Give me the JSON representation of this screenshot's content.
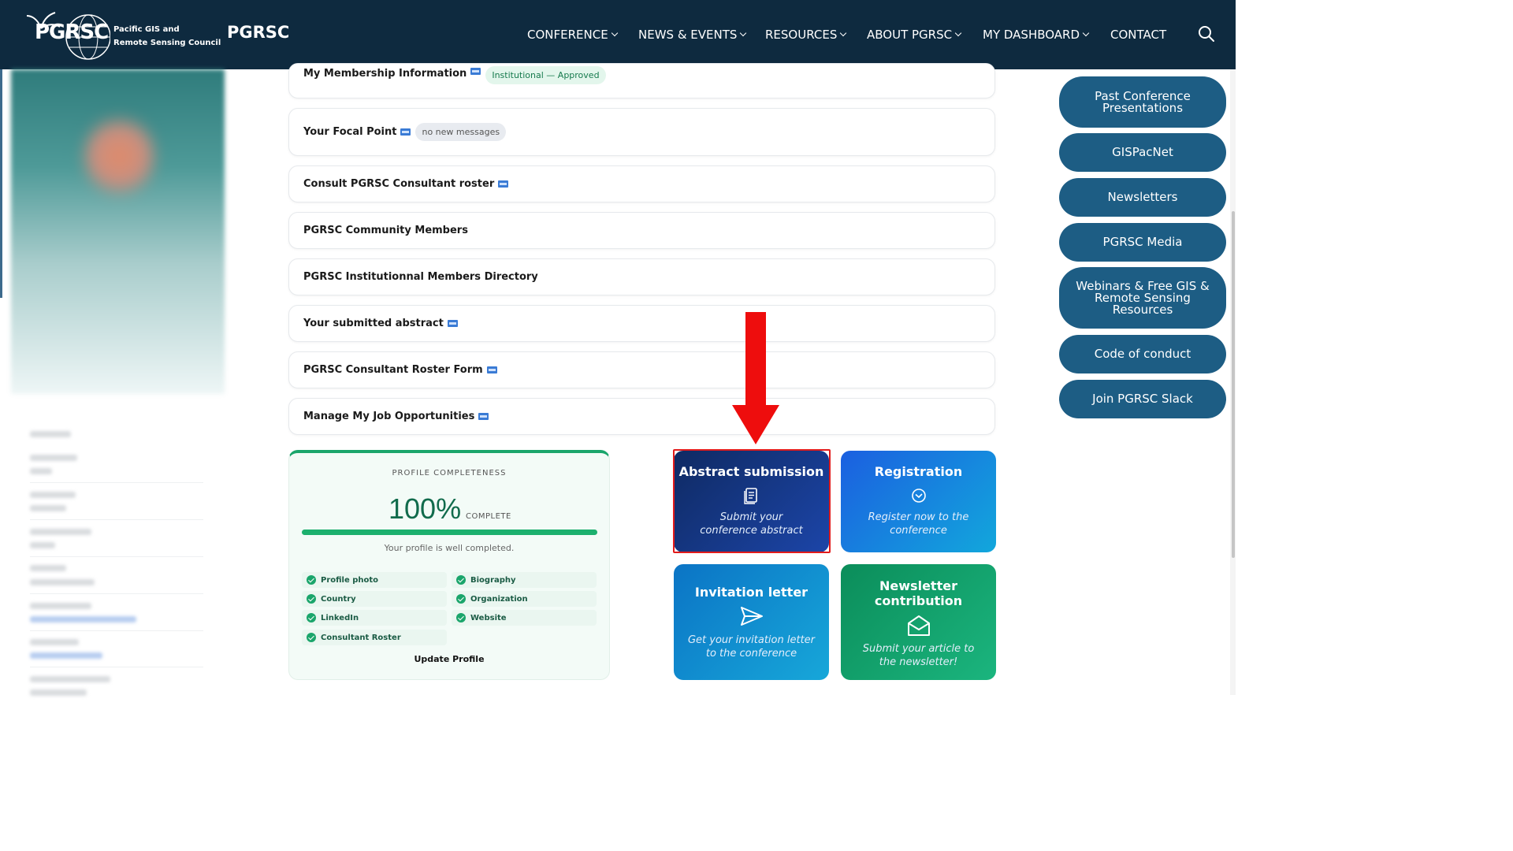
{
  "header": {
    "logo_text": "PGRSC",
    "logo_tagline_line1": "Pacific GIS and",
    "logo_tagline_line2": "Remote Sensing Council",
    "brand": "PGRSC",
    "nav": [
      {
        "label": "CONFERENCE",
        "has_dropdown": true
      },
      {
        "label": "NEWS & EVENTS",
        "has_dropdown": true
      },
      {
        "label": "RESOURCES",
        "has_dropdown": true
      },
      {
        "label": "ABOUT PGRSC",
        "has_dropdown": true
      },
      {
        "label": "MY DASHBOARD",
        "has_dropdown": true
      },
      {
        "label": "CONTACT",
        "has_dropdown": false
      }
    ],
    "search_icon": "search-icon"
  },
  "dashboard": {
    "rows": [
      {
        "label": "My Membership Information",
        "new": true,
        "pill": "Institutional — Approved",
        "pill_style": "green"
      },
      {
        "label": "Your Focal Point",
        "new": true,
        "pill": "no new messages",
        "pill_style": "grey"
      },
      {
        "label": "Consult PGRSC Consultant roster",
        "new": true
      },
      {
        "label": "PGRSC Community Members",
        "new": false
      },
      {
        "label": "PGRSC Institutionnal Members Directory",
        "new": false
      },
      {
        "label": "Your submitted abstract",
        "new": true
      },
      {
        "label": "PGRSC Consultant Roster Form",
        "new": true
      },
      {
        "label": "Manage My Job Opportunities",
        "new": true
      }
    ]
  },
  "profile_completeness": {
    "title": "PROFILE COMPLETENESS",
    "percent": "100%",
    "percent_value": 100,
    "complete_label": "COMPLETE",
    "message": "Your profile is well completed.",
    "items": [
      "Profile photo",
      "Biography",
      "Country",
      "Organization",
      "LinkedIn",
      "Website",
      "Consultant Roster"
    ],
    "update_label": "Update Profile",
    "accent_color": "#1aa56b"
  },
  "tiles": [
    {
      "title": "Abstract submission",
      "subtitle": "Submit your conference abstract",
      "icon": "document-icon"
    },
    {
      "title": "Registration",
      "subtitle": "Register now to the conference",
      "icon": "check-circle-icon"
    },
    {
      "title": "Invitation letter",
      "subtitle": "Get your invitation letter to the conference",
      "icon": "send-icon"
    },
    {
      "title": "Newsletter contribution",
      "subtitle": "Submit your article to the newsletter!",
      "icon": "envelope-open-icon"
    }
  ],
  "sidebar_links": [
    "Past Conference Presentations",
    "GISPacNet",
    "Newsletters",
    "PGRSC Media",
    "Webinars & Free GIS & Remote Sensing Resources",
    "Code of conduct",
    "Join PGRSC Slack"
  ],
  "colors": {
    "header_bg": "#0e2a3f",
    "sidebar_button": "#1d5d84",
    "highlight": "#e21b1b",
    "arrow": "#ee0d0d"
  }
}
